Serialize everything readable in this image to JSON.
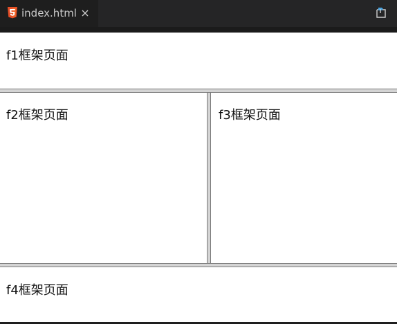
{
  "editor": {
    "tab_title": "index.html",
    "tab_icon": "html5-icon",
    "accent_color": "#e44d26",
    "action_icon": "open-preview-icon"
  },
  "frames": {
    "f1": "f1框架页面",
    "f2": "f2框架页面",
    "f3": "f3框架页面",
    "f4": "f4框架页面"
  }
}
